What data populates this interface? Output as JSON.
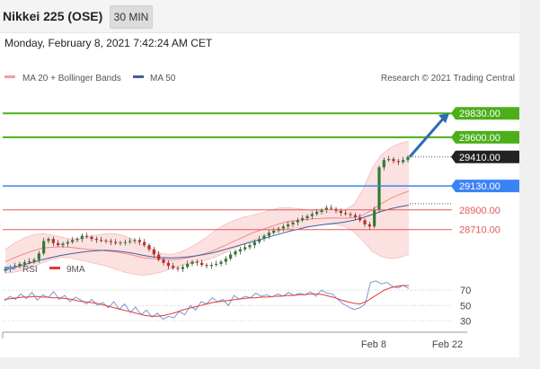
{
  "header": {
    "title": "Nikkei 225 (OSE)",
    "timeframe": "30 MIN",
    "datetime": "Monday, February 8, 2021 7:42:24 AM CET"
  },
  "legend": {
    "ma20_label": "MA 20 + Bollinger Bands",
    "ma50_label": "MA 50",
    "copyright": "Research © 2021 Trading Central",
    "rsi_label": "RSI",
    "ma9_label": "9MA"
  },
  "colors": {
    "resistance": "#4caf1a",
    "pivot": "#3b82f6",
    "support": "#e05a5a",
    "last_price": "#222222",
    "arrow": "#2f6bb5",
    "candle_up": "#2e7d32",
    "candle_down": "#c62828",
    "rsi": "#6b8fd6",
    "rsi_ma": "#e53935",
    "band_fill": "#f9c9c9",
    "ma20": "#f08080",
    "ma50": "#3f5f9f"
  },
  "chart_data": [
    {
      "type": "candlestick",
      "name": "price",
      "ylim": [
        28500,
        30100
      ],
      "x_labels": [
        "Feb 8",
        "Feb 22"
      ],
      "levels": [
        {
          "value": 29830.0,
          "label": "29830.00",
          "kind": "resistance"
        },
        {
          "value": 29600.0,
          "label": "29600.00",
          "kind": "resistance"
        },
        {
          "value": 29410.0,
          "label": "29410.00",
          "kind": "last"
        },
        {
          "value": 29130.0,
          "label": "29130.00",
          "kind": "pivot"
        },
        {
          "value": 28900.0,
          "label": "28900.00",
          "kind": "support"
        },
        {
          "value": 28710.0,
          "label": "28710.00",
          "kind": "support"
        }
      ],
      "close": [
        28330,
        28345,
        28360,
        28380,
        28395,
        28405,
        28420,
        28480,
        28600,
        28620,
        28580,
        28560,
        28575,
        28590,
        28610,
        28620,
        28650,
        28640,
        28620,
        28610,
        28605,
        28600,
        28590,
        28580,
        28585,
        28590,
        28600,
        28610,
        28590,
        28560,
        28520,
        28470,
        28420,
        28390,
        28360,
        28340,
        28330,
        28350,
        28380,
        28400,
        28390,
        28370,
        28360,
        28370,
        28380,
        28400,
        28430,
        28470,
        28500,
        28520,
        28540,
        28560,
        28590,
        28620,
        28650,
        28680,
        28700,
        28720,
        28740,
        28760,
        28780,
        28800,
        28820,
        28840,
        28860,
        28880,
        28900,
        28920,
        28910,
        28890,
        28870,
        28860,
        28850,
        28830,
        28800,
        28760,
        28740,
        28900,
        29310,
        29380,
        29390,
        29370,
        29360,
        29380,
        29410
      ],
      "upper_band": [
        28520,
        28580,
        28630,
        28660,
        28670,
        28660,
        28640,
        28620,
        28620,
        28640,
        28660,
        28670,
        28670,
        28650,
        28610,
        28560,
        28520,
        28480,
        28470,
        28490,
        28530,
        28580,
        28640,
        28710,
        28760,
        28800,
        28830,
        28850,
        28870,
        28900,
        28920,
        28920,
        28910,
        28900,
        28890,
        28880,
        28880,
        28900,
        28950,
        29100,
        29300,
        29430,
        29500,
        29540,
        29560
      ],
      "lower_band": [
        28290,
        28300,
        28320,
        28350,
        28390,
        28420,
        28440,
        28440,
        28420,
        28400,
        28380,
        28360,
        28330,
        28300,
        28280,
        28270,
        28280,
        28300,
        28330,
        28360,
        28380,
        28400,
        28420,
        28450,
        28490,
        28530,
        28570,
        28610,
        28640,
        28670,
        28700,
        28720,
        28730,
        28740,
        28750,
        28760,
        28760,
        28740,
        28690,
        28600,
        28500,
        28450,
        28430,
        28440,
        28470
      ],
      "ma20": [
        28400,
        28440,
        28475,
        28505,
        28530,
        28540,
        28545,
        28540,
        28530,
        28520,
        28515,
        28505,
        28495,
        28480,
        28460,
        28440,
        28430,
        28425,
        28420,
        28425,
        28440,
        28460,
        28485,
        28520,
        28560,
        28600,
        28640,
        28680,
        28710,
        28740,
        28770,
        28790,
        28800,
        28810,
        28815,
        28820,
        28822,
        28820,
        28825,
        28850,
        28900,
        28960,
        29010,
        29050,
        29080
      ],
      "ma50": [
        28320,
        28345,
        28370,
        28395,
        28420,
        28440,
        28460,
        28475,
        28488,
        28500,
        28508,
        28510,
        28505,
        28495,
        28480,
        28462,
        28448,
        28440,
        28438,
        28440,
        28448,
        28460,
        28475,
        28495,
        28520,
        28545,
        28570,
        28595,
        28620,
        28645,
        28670,
        28695,
        28715,
        28735,
        28750,
        28762,
        28772,
        28782,
        28800,
        28825,
        28855,
        28885,
        28910,
        28930,
        28945
      ],
      "projection": {
        "from": 29410,
        "to": 29830
      }
    },
    {
      "type": "line",
      "name": "RSI",
      "ylim": [
        20,
        90
      ],
      "ticks": [
        70,
        50,
        30
      ],
      "rsi": [
        56,
        62,
        58,
        65,
        59,
        67,
        57,
        64,
        60,
        68,
        58,
        63,
        55,
        61,
        57,
        52,
        58,
        50,
        54,
        47,
        55,
        45,
        52,
        41,
        48,
        38,
        44,
        35,
        40,
        32,
        36,
        34,
        42,
        38,
        50,
        44,
        55,
        52,
        60,
        55,
        58,
        50,
        63,
        58,
        62,
        60,
        66,
        62,
        64,
        61,
        65,
        62,
        67,
        63,
        66,
        64,
        68,
        62,
        70,
        66,
        65,
        58,
        52,
        48,
        45,
        47,
        52,
        80,
        82,
        78,
        80,
        75,
        73,
        76,
        72
      ],
      "ma9": [
        58,
        59,
        60,
        61,
        61,
        62,
        61,
        61,
        60,
        60,
        59,
        58,
        56,
        55,
        54,
        53,
        51,
        49,
        47,
        45,
        43,
        41,
        39,
        37,
        36,
        36,
        37,
        39,
        41,
        44,
        46,
        48,
        50,
        52,
        54,
        55,
        56,
        57,
        58,
        59,
        60,
        60,
        61,
        61,
        62,
        62,
        63,
        63,
        64,
        64,
        65,
        65,
        64,
        62,
        60,
        57,
        55,
        53,
        52,
        55,
        60,
        65,
        70,
        73,
        75,
        76,
        76
      ]
    }
  ]
}
